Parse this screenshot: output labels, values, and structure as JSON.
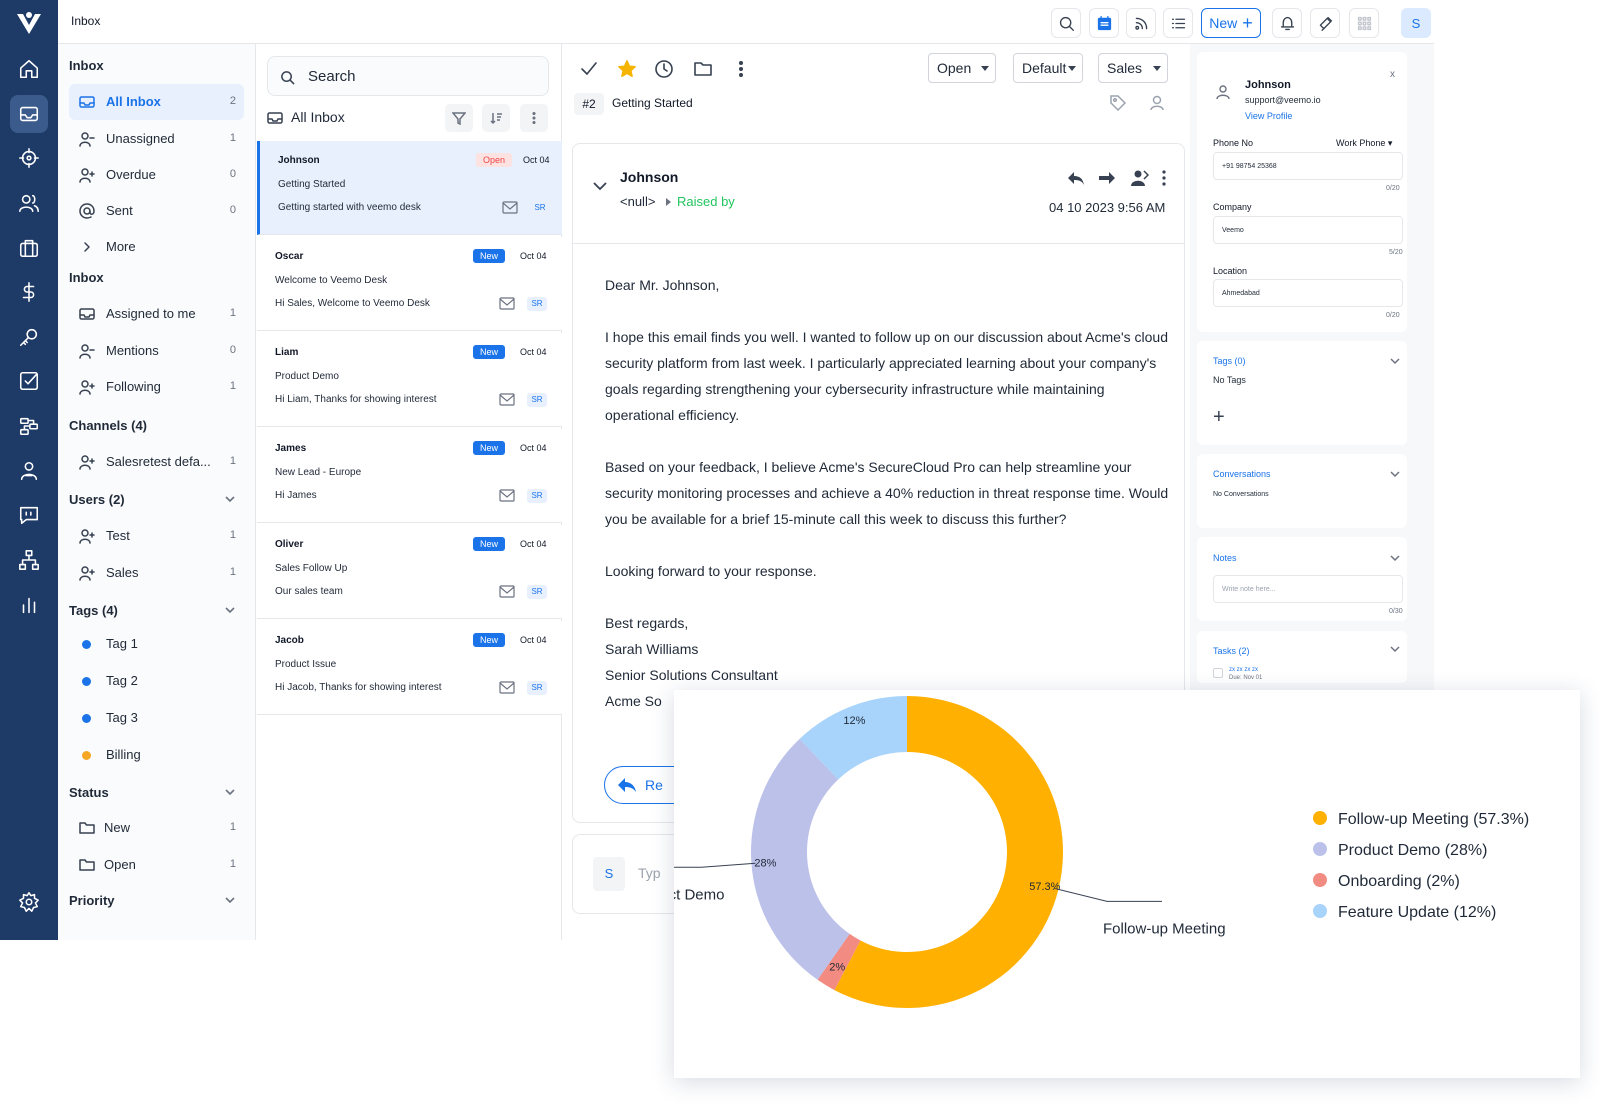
{
  "topbar": {
    "title": "Inbox",
    "new_label": "New",
    "avatar_initial": "S",
    "icons": [
      "search-icon",
      "calendar-icon",
      "feed-icon",
      "list-icon",
      "bell-icon",
      "campaign-icon",
      "apps-grid-icon"
    ]
  },
  "rail": {
    "icons": [
      "home-icon",
      "inbox-icon",
      "target-icon",
      "users-icon",
      "briefcase-icon",
      "dollar-icon",
      "key-icon",
      "task-check-icon",
      "workflow-icon",
      "team-icon",
      "quote-chat-icon",
      "org-chart-icon",
      "bar-chart-icon",
      "settings-icon"
    ],
    "active": "inbox-icon"
  },
  "nav": {
    "inbox_heading": "Inbox",
    "inbox_items": [
      {
        "label": "All Inbox",
        "count": "2"
      },
      {
        "label": "Unassigned",
        "count": "1"
      },
      {
        "label": "Overdue",
        "count": "0"
      },
      {
        "label": "Sent",
        "count": "0"
      },
      {
        "label": "More",
        "count": ""
      }
    ],
    "inbox2_heading": "Inbox",
    "inbox2_items": [
      {
        "label": "Assigned to me",
        "count": "1"
      },
      {
        "label": "Mentions",
        "count": "0"
      },
      {
        "label": "Following",
        "count": "1"
      }
    ],
    "channels_heading": "Channels (4)",
    "channel_items": [
      {
        "label": "Salesretest defa...",
        "count": "1"
      }
    ],
    "users_heading": "Users (2)",
    "user_items": [
      {
        "label": "Test",
        "count": "1"
      },
      {
        "label": "Sales",
        "count": "1"
      }
    ],
    "tags_heading": "Tags (4)",
    "tag_items": [
      {
        "label": "Tag 1",
        "color": "#1a73e8"
      },
      {
        "label": "Tag 2",
        "color": "#1a73e8"
      },
      {
        "label": "Tag 3",
        "color": "#1a73e8"
      },
      {
        "label": "Billing",
        "color": "#f5a623"
      }
    ],
    "status_heading": "Status",
    "status_items": [
      {
        "label": "New",
        "count": "1"
      },
      {
        "label": "Open",
        "count": "1"
      }
    ],
    "priority_heading": "Priority"
  },
  "list": {
    "search_placeholder": "Search",
    "heading": "All Inbox",
    "conversations": [
      {
        "name": "Johnson",
        "badge": "Open",
        "date": "Oct 04",
        "subject": "Getting Started",
        "preview": "Getting started with veemo desk",
        "tag": "SR"
      },
      {
        "name": "Oscar",
        "badge": "New",
        "date": "Oct 04",
        "subject": "Welcome to Veemo Desk",
        "preview": "Hi Sales, Welcome to Veemo Desk",
        "tag": "SR"
      },
      {
        "name": "Liam",
        "badge": "New",
        "date": "Oct 04",
        "subject": "Product Demo",
        "preview": "Hi Liam, Thanks for showing interest",
        "tag": "SR"
      },
      {
        "name": "James",
        "badge": "New",
        "date": "Oct 04",
        "subject": "New Lead - Europe",
        "preview": "Hi James",
        "tag": "SR"
      },
      {
        "name": "Oliver",
        "badge": "New",
        "date": "Oct 04",
        "subject": "Sales Follow Up",
        "preview": "Our sales team",
        "tag": "SR"
      },
      {
        "name": "Jacob",
        "badge": "New",
        "date": "Oct 04",
        "subject": "Product Issue",
        "preview": "Hi Jacob, Thanks for showing interest",
        "tag": "SR"
      }
    ]
  },
  "conversation": {
    "status_dropdown": "Open",
    "priority_dropdown": "Default",
    "team_dropdown": "Sales",
    "ticket_number": "#2",
    "ticket_title": "Getting Started",
    "from_name": "Johnson",
    "from_email": "<null>",
    "raised_by": "Raised by",
    "date": "04 10 2023 9:56 AM",
    "body": [
      "Dear Mr. Johnson,",
      "I hope this email finds you well. I wanted to follow up on our discussion about Acme's cloud security platform from last week. I particularly appreciated learning about your company's goals regarding strengthening your cybersecurity infrastructure while maintaining operational efficiency.",
      "Based on your feedback, I believe Acme's SecureCloud Pro can help streamline your security monitoring processes and achieve a 40% reduction in threat response time. Would you be available for a brief 15-minute call this week to discuss this further?",
      "Looking forward to your response."
    ],
    "signature": [
      "Best regards,",
      "Sarah Williams",
      "Senior Solutions Consultant",
      "Acme So"
    ],
    "reply_label": "Re",
    "compose_avatar": "S",
    "compose_placeholder": "Typ"
  },
  "contact": {
    "name": "Johnson",
    "email": "support@veemo.io",
    "view_profile": "View Profile",
    "close": "x",
    "phone_label": "Phone No",
    "phone_type": "Work Phone",
    "phone_value": "+91 98754 25368",
    "phone_count": "0/20",
    "company_label": "Company",
    "company_value": "Veemo",
    "company_count": "5/20",
    "location_label": "Location",
    "location_value": "Ahmedabad",
    "location_count": "0/20",
    "tags_title": "Tags  (0)",
    "tags_empty": "No Tags",
    "conversations_title": "Conversations",
    "conversations_empty": "No Conversations",
    "notes_title": "Notes",
    "notes_placeholder": "Write note here...",
    "notes_count": "0/30",
    "tasks_title": "Tasks (2)",
    "task_preview": "zx zx zx zx",
    "task_due": "Due: Nov 01"
  },
  "chart_data": {
    "type": "pie",
    "style": "donut",
    "title": "",
    "slices": [
      {
        "label": "Follow-up Meeting",
        "value": 57.3,
        "legend": "Follow-up Meeting (57.3%)",
        "data_label": "57.3%",
        "color": "#ffb000"
      },
      {
        "label": "Onboarding",
        "value": 2,
        "legend": "Onboarding (2%)",
        "data_label": "2%",
        "color": "#f28b82"
      },
      {
        "label": "Product Demo",
        "value": 28,
        "legend": "Product Demo (28%)",
        "data_label": "28%",
        "color": "#bcc1ea"
      },
      {
        "label": "Feature Update",
        "value": 12,
        "legend": "Feature Update (12%)",
        "data_label": "12%",
        "color": "#a8d3fb"
      }
    ],
    "legend_order": [
      "Follow-up Meeting",
      "Product Demo",
      "Onboarding",
      "Feature Update"
    ],
    "callouts": [
      "Follow-up Meeting",
      "Product Demo"
    ],
    "legend_position": "right"
  }
}
